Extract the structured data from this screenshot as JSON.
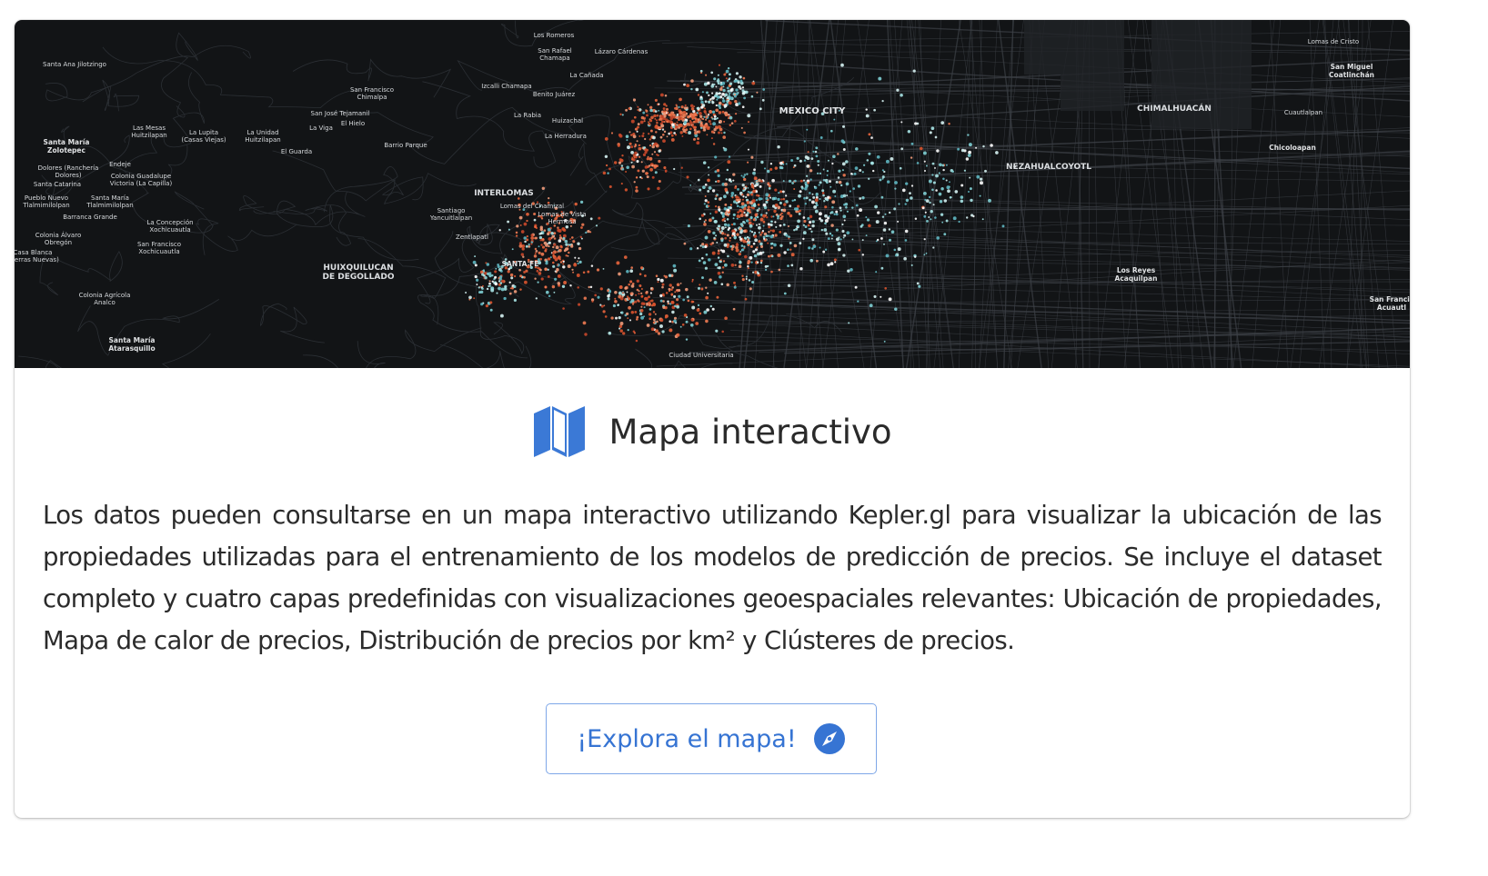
{
  "card": {
    "title": "Mapa interactivo",
    "description": "Los datos pueden consultarse en un mapa interactivo utilizando Kepler.gl para visualizar la ubicación de las propiedades utilizadas para el entrenamiento de los modelos de predicción de precios. Se incluye el dataset completo y cuatro capas predefinidas con visualizaciones geoespaciales relevantes: Ubicación de propiedades, Mapa de calor de precios, Distribución de precios por km² y Clústeres de precios.",
    "button_label": "¡Explora el mapa!",
    "title_icon": "map-icon",
    "button_icon": "compass-icon"
  },
  "map": {
    "labels": {
      "mexico_city": "MEXICO CITY",
      "chimalhuacan": "CHIMALHUACÁN",
      "nezahualcoyotl": "NEZAHUALCOYOTL",
      "interlomas": "INTERLOMAS",
      "huixquilucan": "HUIXQUILUCAN\nDE DEGOLLADO",
      "santa_maria_zolotepec": "Santa María\nZolotepec",
      "santa_maria_atarasquillo": "Santa María\nAtarasquillo",
      "san_miguel_coatlinchan": "San Miguel\nCoatlinchán",
      "chicoloapan": "Chicoloapan",
      "los_reyes": "Los Reyes\nAcaquilpan",
      "san_francisco": "San Francis\nAcuautl",
      "santa_fe": "SANTA FE",
      "ciudad_universitaria": "Ciudad Universitaria",
      "lomas_de_cristo": "Lomas de Cristo",
      "cuautlalpan": "Cuautlalpan",
      "los_romeros": "Los Romeros",
      "santa_ana_jilotzingo": "Santa Ana Jilotzingo",
      "san_rafael_chamapa": "San Rafael\nChamapa",
      "lazaro_cardenas": "Lázaro Cárdenas",
      "la_canada": "La Cañada",
      "benito_juarez": "Benito Juárez",
      "lomas_mesas": "Las Mesas\nHuitzilapan",
      "la_lupita": "La Lupita\n(Casas Viejas)",
      "la_unidad": "La Unidad\nHuitzilapan",
      "la_viga": "La Viga",
      "el_hielo": "El Hielo",
      "san_jose_tejamanil": "San José Tejamanil",
      "san_francisco_chimalpa": "San Francisco\nChimalpa",
      "el_guarda": "El Guarda",
      "barrio_parque": "Barrio Parque",
      "la_herradura": "La Herradura",
      "huizachal": "Huizachal",
      "la_rabia": "La Rabia",
      "dolores": "Dolores (Ranchería\nDolores)",
      "endeje": "Endeje",
      "colonia_guadalupe": "Colonia Guadalupe\nVictoria (La Capilla)",
      "santa_catarina": "Santa Catarina",
      "pueblo_nuevo": "Pueblo Nuevo\nTlalmimilolpan",
      "santa_maria_tlal": "Santa María\nTlalmimilolpan",
      "barranca_grande": "Barranca Grande",
      "la_concepcion": "La Concepción\nXochicuautla",
      "colonia_alvaro": "Colonia Álvaro\nObregón",
      "san_francisco_xochi": "San Francisco\nXochicuautla",
      "casa_blanca": "Casa Blanca\n(Tierras Nuevas)",
      "colonia_agricola": "Colonia Agrícola\nAnalco",
      "santiago_yancu": "Santiago\nYancuitlalpan",
      "lomas_del_chamizal": "Lomas del Chamizal",
      "zentlapatl": "Zentlapatl",
      "lomas_de_vista": "Lomas de Vista\nHermosa"
    },
    "colors": {
      "background": "#121416",
      "roads": "#3d4147",
      "warm": "#e8643c",
      "cool": "#a9e4e6"
    }
  },
  "colors": {
    "accent": "#3674d3",
    "button_border": "#7ea7e8",
    "icon_blue": "#3b79d6"
  }
}
